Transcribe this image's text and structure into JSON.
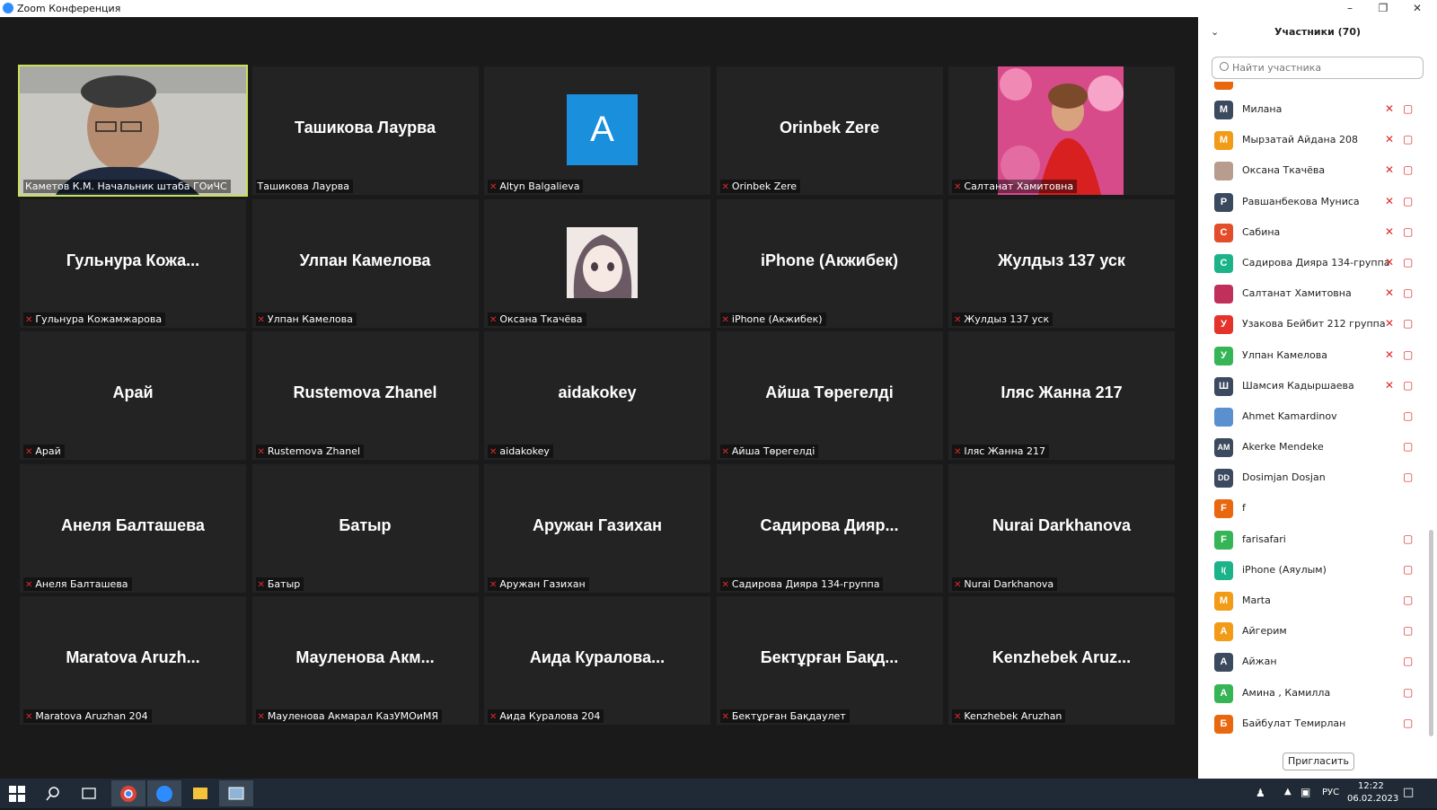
{
  "window": {
    "title": "Zoom Конференция"
  },
  "tiles": [
    {
      "big": "",
      "label": "Каметов К.М. Начальник штаба ГОиЧС",
      "video": true,
      "active": true,
      "muted": false
    },
    {
      "big": "Ташикова Лаурва",
      "label": "Ташикова Лаурва",
      "muted": false
    },
    {
      "big": "",
      "label": "Altyn Balgalieva",
      "avatar_letter": "A",
      "muted": true
    },
    {
      "big": "Orinbek Zere",
      "label": "Orinbek Zere",
      "muted": true
    },
    {
      "big": "",
      "label": "Салтанат Хамитовна",
      "photo": "flowers",
      "muted": true
    },
    {
      "big": "Гульнура Кожа...",
      "label": "Гульнура Кожамжарова",
      "muted": true
    },
    {
      "big": "Улпан Камелова",
      "label": "Улпан Камелова",
      "muted": true
    },
    {
      "big": "",
      "label": "Оксана Ткачёва",
      "photo": "anime",
      "muted": true
    },
    {
      "big": "iPhone (Акжибек)",
      "label": "iPhone (Акжибек)",
      "muted": true
    },
    {
      "big": "Жулдыз 137 уск",
      "label": "Жулдыз 137 уск",
      "muted": true
    },
    {
      "big": "Арай",
      "label": "Арай",
      "muted": true
    },
    {
      "big": "Rustemova Zhanel",
      "label": "Rustemova Zhanel",
      "muted": true
    },
    {
      "big": "aidakokey",
      "label": "aidakokey",
      "muted": true
    },
    {
      "big": "Айша Төрегелді",
      "label": "Айша Төрегелді",
      "muted": true
    },
    {
      "big": "Іляс Жанна 217",
      "label": "Іляс Жанна 217",
      "muted": true
    },
    {
      "big": "Анеля Балташева",
      "label": "Анеля Балташева",
      "muted": true
    },
    {
      "big": "Батыр",
      "label": "Батыр",
      "muted": true
    },
    {
      "big": "Аружан Газихан",
      "label": "Аружан Газихан",
      "muted": true
    },
    {
      "big": "Садирова Дияр...",
      "label": "Садирова Диярa 134-группа",
      "muted": true
    },
    {
      "big": "Nurai Darkhanova",
      "label": "Nurai Darkhanova",
      "muted": true
    },
    {
      "big": "Maratova Aruzh...",
      "label": "Maratova Aruzhan 204",
      "muted": true
    },
    {
      "big": "Мауленова Акм...",
      "label": "Мауленова Акмарал КазУМОиМЯ",
      "muted": true
    },
    {
      "big": "Аида Куралова...",
      "label": "Аида Куралова 204",
      "muted": true
    },
    {
      "big": "Бектұрған Бақд...",
      "label": "Бектұрған Бақдаулет",
      "muted": true
    },
    {
      "big": "Kenzhebek Aruz...",
      "label": "Kenzhebek Aruzhan",
      "muted": true
    }
  ],
  "participants": {
    "header": "Участники (70)",
    "search_placeholder": "Найти участника",
    "invite_label": "Пригласить",
    "list": [
      {
        "initial": "М",
        "color": "#3b4a5e",
        "name": "Милана",
        "mic_muted": true
      },
      {
        "initial": "М",
        "color": "#f29b17",
        "name": "Мырзатай Айдана 208",
        "mic_muted": true
      },
      {
        "initial": "",
        "color": "#b89c8e",
        "name": "Оксана Ткачёва",
        "mic_muted": true,
        "photo": true
      },
      {
        "initial": "Р",
        "color": "#3b4a5e",
        "name": "Равшанбекова Муниса",
        "mic_muted": true
      },
      {
        "initial": "С",
        "color": "#e34d2a",
        "name": "Сабина",
        "mic_muted": true
      },
      {
        "initial": "С",
        "color": "#1bb38a",
        "name": "Садирова Диярa 134-группа",
        "mic_muted": true
      },
      {
        "initial": "",
        "color": "#c0305a",
        "name": "Салтанат Хамитовна",
        "mic_muted": true,
        "photo": true
      },
      {
        "initial": "У",
        "color": "#e3332a",
        "name": "Узакова Бейбит 212 группа",
        "mic_muted": true
      },
      {
        "initial": "У",
        "color": "#35b556",
        "name": "Улпан Камелова",
        "mic_muted": true
      },
      {
        "initial": "Ш",
        "color": "#3b4a5e",
        "name": "Шамсия Кадыршаева",
        "mic_muted": true
      },
      {
        "initial": "",
        "color": "#5a8fd0",
        "name": "Ahmet Kamardinov",
        "mic_muted": false,
        "photo": true
      },
      {
        "initial": "AM",
        "color": "#3b4a5e",
        "name": "Akerke Mendeke",
        "mic_muted": false
      },
      {
        "initial": "DD",
        "color": "#3b4a5e",
        "name": "Dosimjan Dosjan",
        "mic_muted": false
      },
      {
        "initial": "F",
        "color": "#e8670f",
        "name": "f",
        "mic_muted": false,
        "no_video_icon": true
      },
      {
        "initial": "F",
        "color": "#35b556",
        "name": "farisafari",
        "mic_muted": false
      },
      {
        "initial": "I(",
        "color": "#1bb38a",
        "name": "iPhone (Аяулым)",
        "mic_muted": false
      },
      {
        "initial": "M",
        "color": "#f29b17",
        "name": "Marta",
        "mic_muted": false
      },
      {
        "initial": "А",
        "color": "#f29b17",
        "name": "Айгерим",
        "mic_muted": false
      },
      {
        "initial": "А",
        "color": "#3b4a5e",
        "name": "Айжан",
        "mic_muted": false
      },
      {
        "initial": "А",
        "color": "#35b556",
        "name": "Амина , Камилла",
        "mic_muted": false
      },
      {
        "initial": "Б",
        "color": "#e8670f",
        "name": "Байбулат Темирлан",
        "mic_muted": false
      }
    ]
  },
  "taskbar": {
    "lang": "РУС",
    "time": "12:22",
    "date": "06.02.2023"
  },
  "colors": {
    "active_speaker": "#c8e05a",
    "tile_bg": "#232323",
    "mute_red": "#e02828",
    "altyn_avatar": "#1a8fdc"
  }
}
